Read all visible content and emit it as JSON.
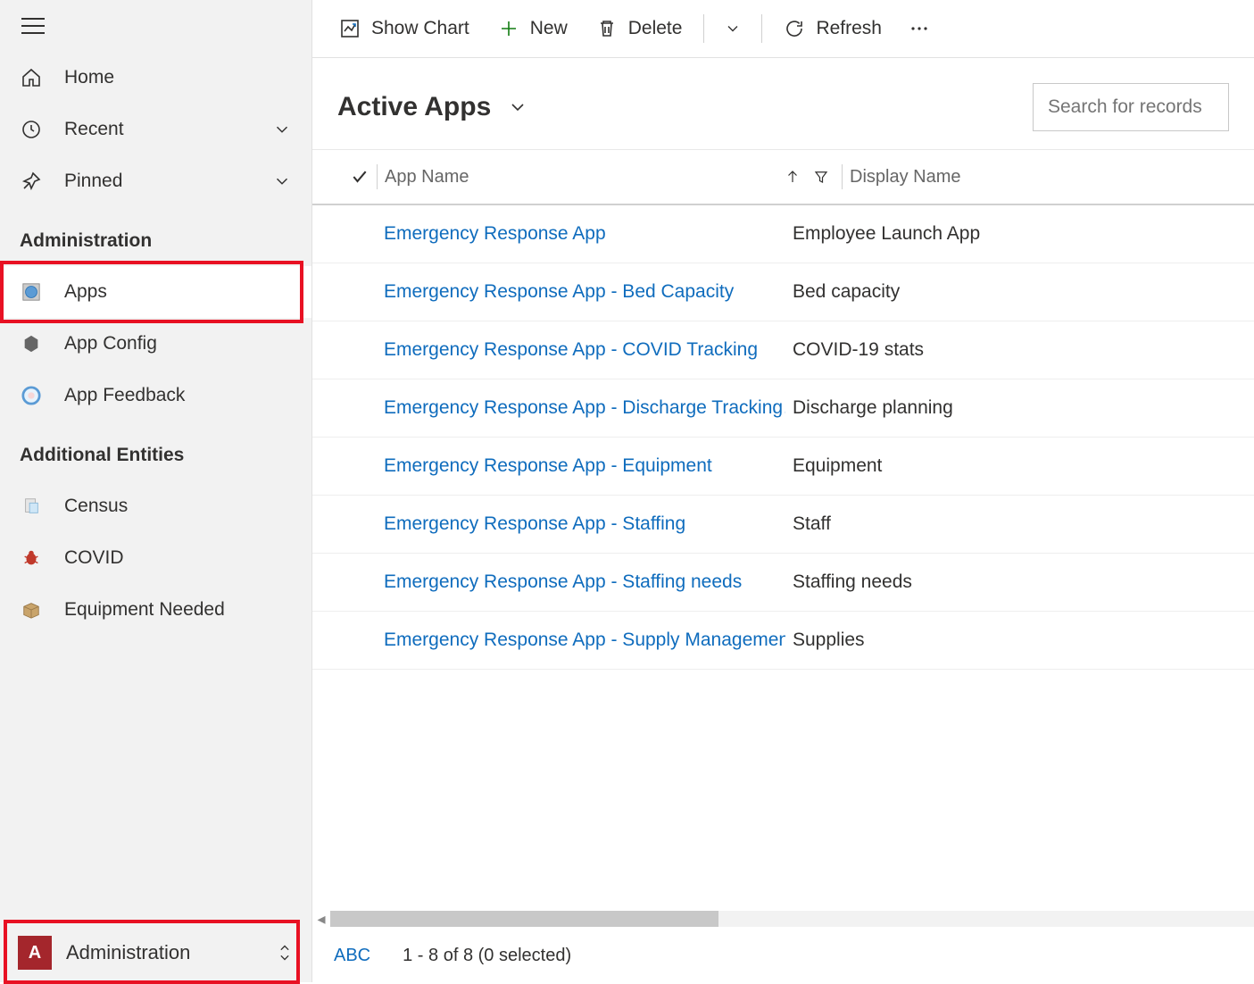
{
  "sidebar": {
    "top": {
      "home": "Home",
      "recent": "Recent",
      "pinned": "Pinned"
    },
    "section1": {
      "header": "Administration",
      "apps": "Apps",
      "appConfig": "App Config",
      "appFeedback": "App Feedback"
    },
    "section2": {
      "header": "Additional Entities",
      "census": "Census",
      "covid": "COVID",
      "equipmentNeeded": "Equipment Needed"
    },
    "areaSwitcher": {
      "badge": "A",
      "label": "Administration"
    }
  },
  "toolbar": {
    "showChart": "Show Chart",
    "new": "New",
    "delete": "Delete",
    "refresh": "Refresh"
  },
  "view": {
    "title": "Active Apps",
    "searchPlaceholder": "Search for records"
  },
  "grid": {
    "headers": {
      "appName": "App Name",
      "displayName": "Display Name"
    },
    "rows": [
      {
        "name": "Emergency Response App",
        "display": "Employee Launch App"
      },
      {
        "name": "Emergency Response App - Bed Capacity",
        "display": "Bed capacity"
      },
      {
        "name": "Emergency Response App - COVID Tracking",
        "display": "COVID-19 stats"
      },
      {
        "name": "Emergency Response App - Discharge Tracking…",
        "display": "Discharge planning"
      },
      {
        "name": "Emergency Response App - Equipment",
        "display": "Equipment"
      },
      {
        "name": "Emergency Response App - Staffing",
        "display": "Staff"
      },
      {
        "name": "Emergency Response App - Staffing needs",
        "display": "Staffing needs"
      },
      {
        "name": "Emergency Response App - Supply Managemen",
        "display": "Supplies"
      }
    ]
  },
  "footer": {
    "abc": "ABC",
    "status": "1 - 8 of 8 (0 selected)"
  }
}
